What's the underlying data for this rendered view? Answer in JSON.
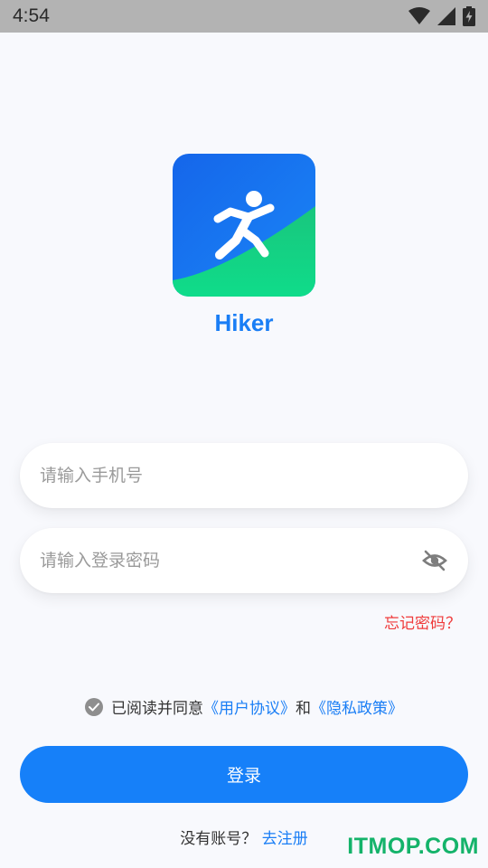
{
  "status_bar": {
    "time": "4:54",
    "icons": [
      "wifi-icon",
      "signal-icon",
      "battery-charging-icon"
    ]
  },
  "app": {
    "name": "Hiker",
    "logo_icon": "running-man-icon",
    "colors": {
      "brand_blue": "#1a7ef5",
      "brand_green": "#14d488"
    }
  },
  "form": {
    "phone_placeholder": "请输入手机号",
    "phone_value": "",
    "password_placeholder": "请输入登录密码",
    "password_value": "",
    "password_toggle_icon": "eye-off-icon",
    "forgot_password": "忘记密码？"
  },
  "agreement": {
    "prefix": "已阅读并同意",
    "user_agreement": "《用户协议》",
    "and": "和",
    "privacy_policy": "《隐私政策》",
    "checked": true
  },
  "login_button": "登录",
  "register": {
    "prompt": "没有账号？",
    "link": "去注册"
  },
  "watermark": "ITMOP.COM"
}
